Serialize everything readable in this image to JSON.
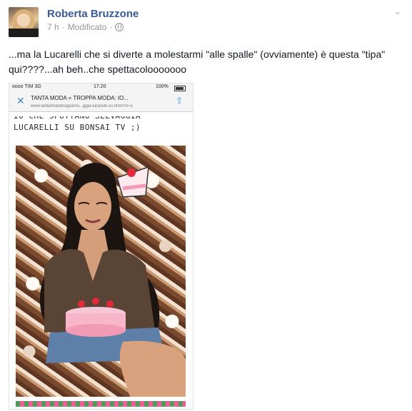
{
  "post": {
    "author_name": "Roberta Bruzzone",
    "time": "7 h",
    "separator": "·",
    "edited_label": "Modificato",
    "separator2": "·",
    "text": "...ma la Lucarelli che si diverte a molestarmi \"alle spalle\" (ovviamente) è questa \"tipa\" qui????...ah beh..che spettacolooooooo"
  },
  "embedded_screenshot": {
    "status": {
      "carrier": "oooo TIM  3G",
      "time": "17:20",
      "battery": "100%"
    },
    "browser": {
      "close_icon": "close-icon",
      "page_title": "TANTA MODA = TROPPA MODA: IO...",
      "url": "www.tantamodatroppamo...ggia-lucarelli-su.html?m=1",
      "share_icon": "share-icon"
    },
    "caption_top": "IO CHE SPUTTANO SELVAGGIA",
    "caption_bottom": "LUCARELLI SU BONSAI TV ;)"
  },
  "colors": {
    "author": "#3b5998",
    "meta": "#90949c",
    "text": "#141823",
    "link_blue": "#3b8ed8"
  }
}
